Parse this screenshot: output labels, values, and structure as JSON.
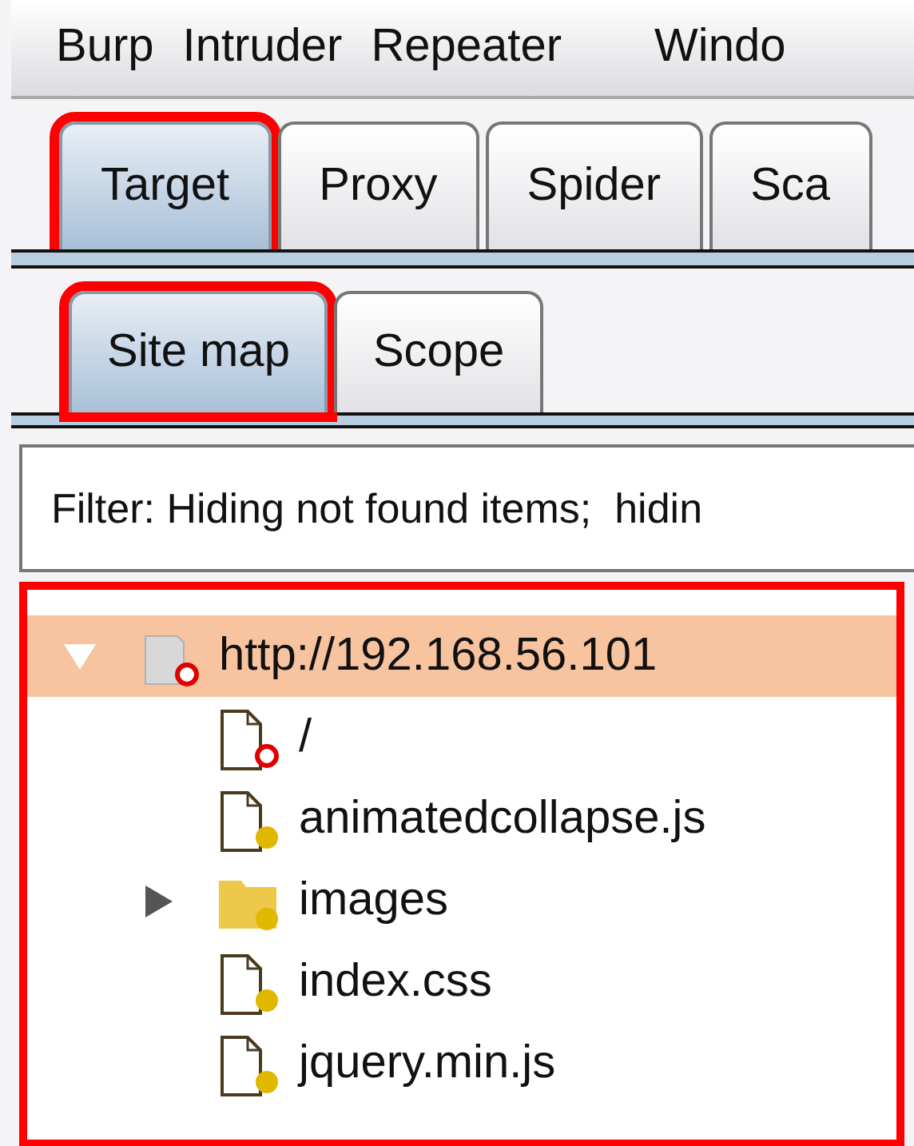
{
  "menu_bar": [
    "Burp",
    "Intruder",
    "Repeater",
    "Windo"
  ],
  "tabs": [
    {
      "label": "Target",
      "selected": true,
      "highlighted": true
    },
    {
      "label": "Proxy",
      "selected": false,
      "highlighted": false
    },
    {
      "label": "Spider",
      "selected": false,
      "highlighted": false
    },
    {
      "label": "Sca",
      "selected": false,
      "highlighted": false
    }
  ],
  "subtabs": [
    {
      "label": "Site map",
      "selected": true,
      "highlighted": true
    },
    {
      "label": "Scope",
      "selected": false,
      "highlighted": false
    }
  ],
  "filter": "Filter: Hiding not found items;  hidin",
  "site_map": {
    "highlighted": true,
    "items": [
      {
        "label": "http://192.168.56.101",
        "kind": "host",
        "requested": false,
        "expanded": true,
        "selected": true,
        "children": [
          {
            "label": "/",
            "kind": "file",
            "requested": false,
            "selected": false
          },
          {
            "label": "animatedcollapse.js",
            "kind": "file",
            "requested": true,
            "selected": false
          },
          {
            "label": "images",
            "kind": "folder",
            "requested": true,
            "expanded": false,
            "selected": false
          },
          {
            "label": "index.css",
            "kind": "file",
            "requested": true,
            "selected": false
          },
          {
            "label": "jquery.min.js",
            "kind": "file",
            "requested": true,
            "selected": false
          }
        ]
      }
    ]
  }
}
